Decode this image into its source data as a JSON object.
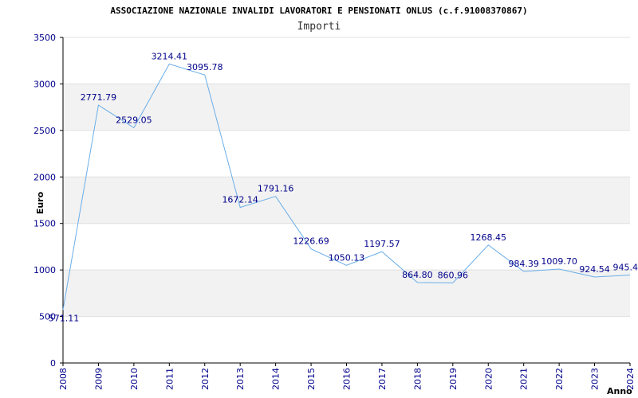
{
  "chart_data": {
    "type": "line",
    "title": "ASSOCIAZIONE NAZIONALE INVALIDI LAVORATORI E PENSIONATI ONLUS (c.f.91008370867)",
    "subtitle": "Importi",
    "xlabel": "Anno",
    "ylabel": "Euro",
    "ylim": [
      0,
      3500
    ],
    "yticks": [
      0,
      500,
      1000,
      1500,
      2000,
      2500,
      3000,
      3500
    ],
    "grid": "alternating horizontal bands",
    "categories": [
      "2008",
      "2009",
      "2010",
      "2011",
      "2012",
      "2013",
      "2014",
      "2015",
      "2016",
      "2017",
      "2018",
      "2019",
      "2020",
      "2021",
      "2022",
      "2023",
      "2024"
    ],
    "values": [
      571.11,
      2771.79,
      2529.05,
      3214.41,
      3095.78,
      1672.14,
      1791.16,
      1226.69,
      1050.13,
      1197.57,
      864.8,
      860.96,
      1268.45,
      984.39,
      1009.7,
      924.54,
      945.4
    ],
    "labels": [
      "571.11",
      "2771.79",
      "2529.05",
      "3214.41",
      "3095.78",
      "1672.14",
      "1791.16",
      "1226.69",
      "1050.13",
      "1197.57",
      "864.80",
      "860.96",
      "1268.45",
      "984.39",
      "1009.70",
      "924.54",
      "945.4"
    ],
    "colors": {
      "line": "#6aaee8",
      "band": "#f2f2f2",
      "text": "#00008b",
      "axis": "#000000"
    }
  }
}
